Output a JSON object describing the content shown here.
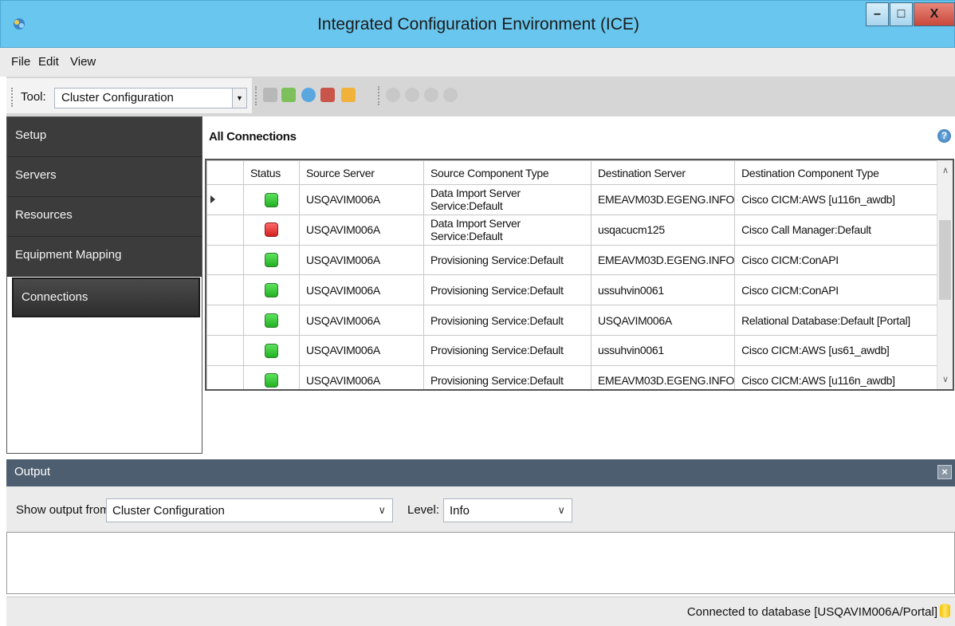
{
  "window": {
    "title": "Integrated Configuration Environment (ICE)",
    "min_label": "–",
    "max_label": "□",
    "close_label": "X"
  },
  "menu": {
    "items": [
      "File",
      "Edit",
      "View"
    ]
  },
  "toolbar": {
    "tool_label": "Tool:",
    "tool_value": "Cluster Configuration"
  },
  "sidebar": {
    "items": [
      "Setup",
      "Servers",
      "Resources",
      "Equipment Mapping",
      "Connections"
    ],
    "active": "Connections"
  },
  "main": {
    "title": "All Connections"
  },
  "grid": {
    "columns": [
      "Status",
      "Source Server",
      "Source Component Type",
      "Destination Server",
      "Destination Component Type"
    ],
    "rows": [
      {
        "status": "green",
        "source_server": "USQAVIM006A",
        "source_type": "Data Import Server Service:Default",
        "dest_server": "EMEAVM03D.EGENG.INFO",
        "dest_type": "Cisco CICM:AWS [u116n_awdb]"
      },
      {
        "status": "red",
        "source_server": "USQAVIM006A",
        "source_type": "Data Import Server Service:Default",
        "dest_server": "usqacucm125",
        "dest_type": "Cisco Call Manager:Default"
      },
      {
        "status": "green",
        "source_server": "USQAVIM006A",
        "source_type": "Provisioning Service:Default",
        "dest_server": "EMEAVM03D.EGENG.INFO",
        "dest_type": "Cisco CICM:ConAPI"
      },
      {
        "status": "green",
        "source_server": "USQAVIM006A",
        "source_type": "Provisioning Service:Default",
        "dest_server": "ussuhvin0061",
        "dest_type": "Cisco CICM:ConAPI"
      },
      {
        "status": "green",
        "source_server": "USQAVIM006A",
        "source_type": "Provisioning Service:Default",
        "dest_server": "USQAVIM006A",
        "dest_type": "Relational Database:Default [Portal]"
      },
      {
        "status": "green",
        "source_server": "USQAVIM006A",
        "source_type": "Provisioning Service:Default",
        "dest_server": "ussuhvin0061",
        "dest_type": "Cisco CICM:AWS [us61_awdb]"
      },
      {
        "status": "green",
        "source_server": "USQAVIM006A",
        "source_type": "Provisioning Service:Default",
        "dest_server": "EMEAVM03D.EGENG.INFO",
        "dest_type": "Cisco CICM:AWS [u116n_awdb]"
      }
    ]
  },
  "output": {
    "title": "Output",
    "show_from_label": "Show output from:",
    "show_from_value": "Cluster Configuration",
    "level_label": "Level:",
    "level_value": "Info"
  },
  "status_bar": {
    "text": "Connected to database [USQAVIM006A/Portal]"
  },
  "colors": {
    "titlebar": "#69c6ee",
    "sidebar": "#3c3c3c",
    "output_header": "#4d5e70",
    "status_ok": "#22b022",
    "status_error": "#d42020"
  }
}
